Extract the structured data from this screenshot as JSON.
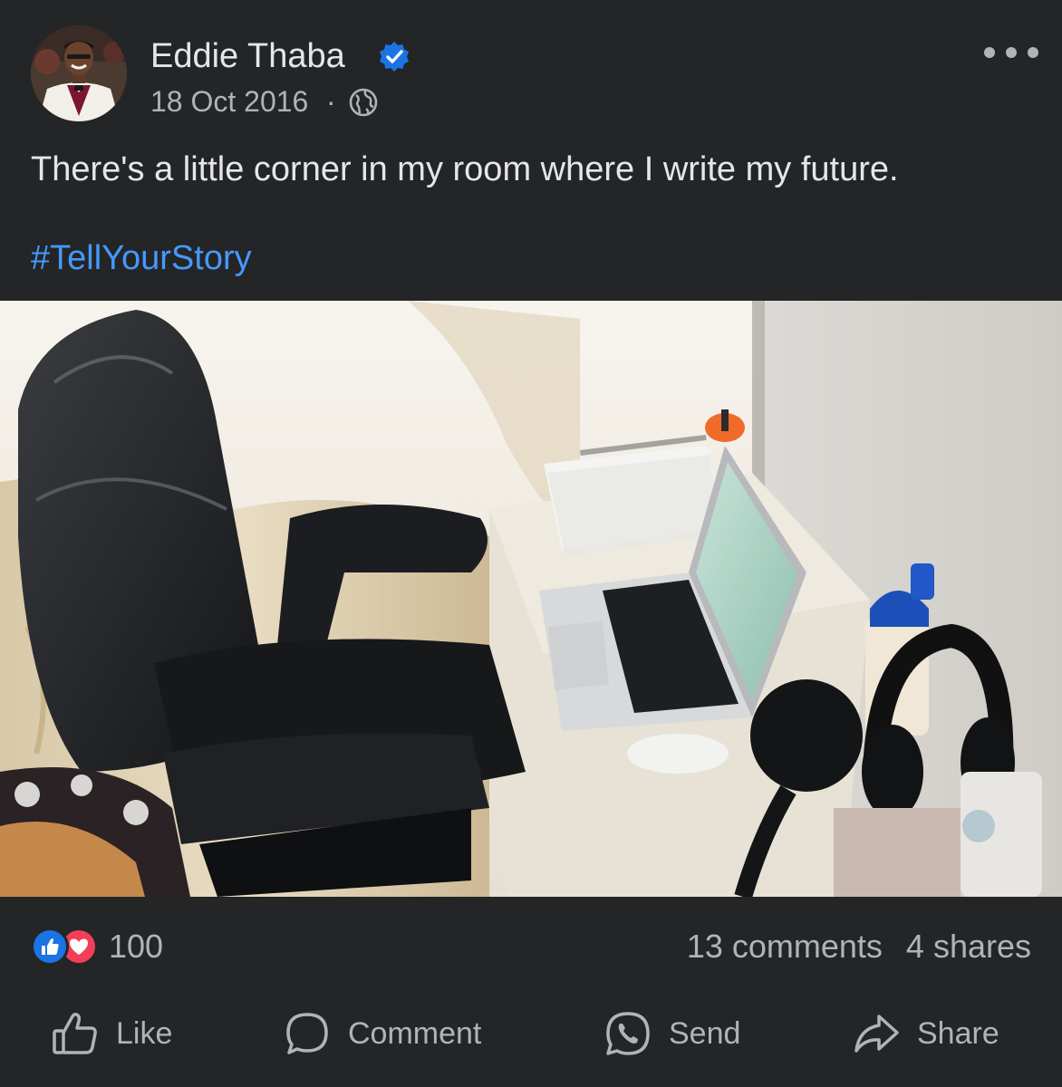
{
  "post": {
    "author": "Eddie Thaba",
    "verified": true,
    "date": "18 Oct 2016",
    "separator": "·",
    "audience_icon": "globe-icon",
    "text": "There's a little corner in my room where I write my future.",
    "hashtag": "#TellYourStory"
  },
  "engagement": {
    "reaction_icons": [
      "like-icon",
      "love-icon"
    ],
    "reaction_count": "100",
    "comments": "13 comments",
    "shares": "4 shares"
  },
  "actions": {
    "like": "Like",
    "comment": "Comment",
    "send": "Send",
    "share": "Share"
  },
  "colors": {
    "background": "#242526",
    "primary_text": "#e4e6eb",
    "secondary_text": "#b0b3b8",
    "link": "#4599ff",
    "verified": "#1b74e4",
    "like": "#1b74e4",
    "love": "#f33e58"
  }
}
